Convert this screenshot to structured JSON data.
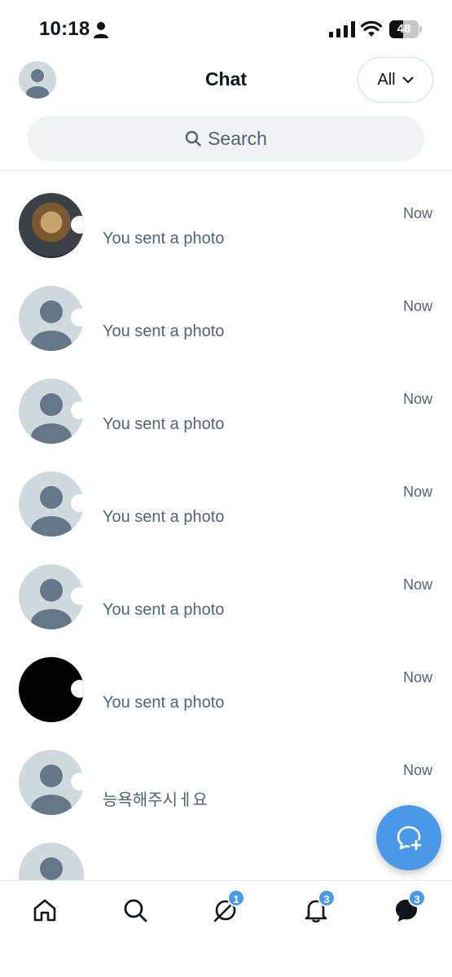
{
  "status_bar": {
    "time": "10:18",
    "battery_level": "48",
    "battery_fraction": 0.48,
    "icons": [
      "person-icon",
      "signal-icon",
      "wifi-icon",
      "battery-icon"
    ]
  },
  "header": {
    "title": "Chat",
    "filter_label": "All",
    "search_placeholder": "Search"
  },
  "colors": {
    "accent": "#4a99e9",
    "muted_text": "#536471",
    "avatar_placeholder": "#cfd9de",
    "search_bg": "#eff3f4"
  },
  "chats": [
    {
      "name": "",
      "preview": "You sent a photo",
      "time": "Now",
      "avatar": "photo"
    },
    {
      "name": "",
      "preview": "You sent a photo",
      "time": "Now",
      "avatar": "default"
    },
    {
      "name": "",
      "preview": "You sent a photo",
      "time": "Now",
      "avatar": "default"
    },
    {
      "name": "",
      "preview": "You sent a photo",
      "time": "Now",
      "avatar": "default"
    },
    {
      "name": "",
      "preview": "You sent a photo",
      "time": "Now",
      "avatar": "default"
    },
    {
      "name": "",
      "preview": "You sent a photo",
      "time": "Now",
      "avatar": "dark"
    },
    {
      "name": "",
      "preview": "능욕해주시ㅔ요",
      "time": "Now",
      "avatar": "default"
    },
    {
      "name": "",
      "preview": "",
      "time": "",
      "avatar": "default"
    }
  ],
  "tab_bar": {
    "tabs": [
      {
        "name": "home-icon",
        "badge": ""
      },
      {
        "name": "search-icon",
        "badge": ""
      },
      {
        "name": "grok-icon",
        "badge": "1"
      },
      {
        "name": "notifications-icon",
        "badge": "3"
      },
      {
        "name": "messages-icon",
        "badge": "3"
      }
    ]
  },
  "fab": {
    "icon": "new-chat-icon"
  }
}
